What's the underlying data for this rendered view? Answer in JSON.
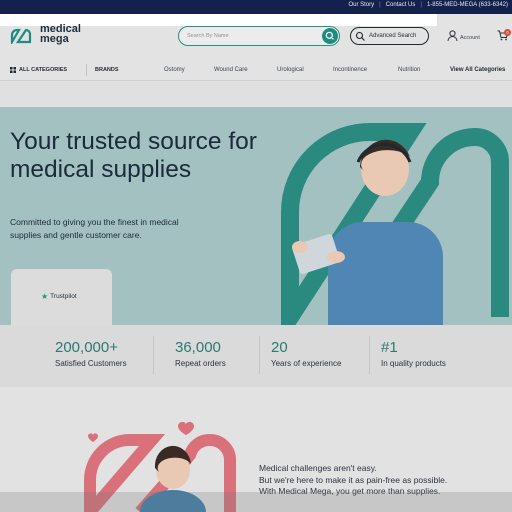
{
  "topbar": {
    "links": [
      "Our Story",
      "Contact Us"
    ],
    "phone": "1-855-MED-MEGA (633-6342)"
  },
  "logo": {
    "line1": "medical",
    "line2": "mega"
  },
  "search": {
    "placeholder": "Search By Name"
  },
  "header": {
    "advanced_search": "Advanced Search",
    "account": "Account",
    "cart_count": "0"
  },
  "nav": {
    "all_categories": "ALL CATEGORIES",
    "brands": "BRANDS",
    "items": [
      "Ostomy",
      "Wound Care",
      "Urological",
      "Incontinence",
      "Nutrition"
    ],
    "view_all": "View All Categories"
  },
  "hero": {
    "title": "Your trusted source for medical supplies",
    "subtitle": "Committed to giving you the finest in medical supplies and gentle customer care.",
    "trustpilot": "Trustpilot"
  },
  "stats": [
    {
      "value": "200,000+",
      "label": "Satisfied Customers"
    },
    {
      "value": "36,000",
      "label": "Repeat orders"
    },
    {
      "value": "20",
      "label": "Years of experience"
    },
    {
      "value": "#1",
      "label": "In quality products"
    }
  ],
  "lower": {
    "lines": [
      "Medical challenges aren't easy.",
      "But we're here to make it as pain-free as possible.",
      "With Medical Mega, you get more than supplies."
    ]
  },
  "colors": {
    "navy": "#13224d",
    "teal": "#1e8c7e",
    "hero_bg": "#a4c1c1",
    "accent_red": "#d64a3a"
  }
}
